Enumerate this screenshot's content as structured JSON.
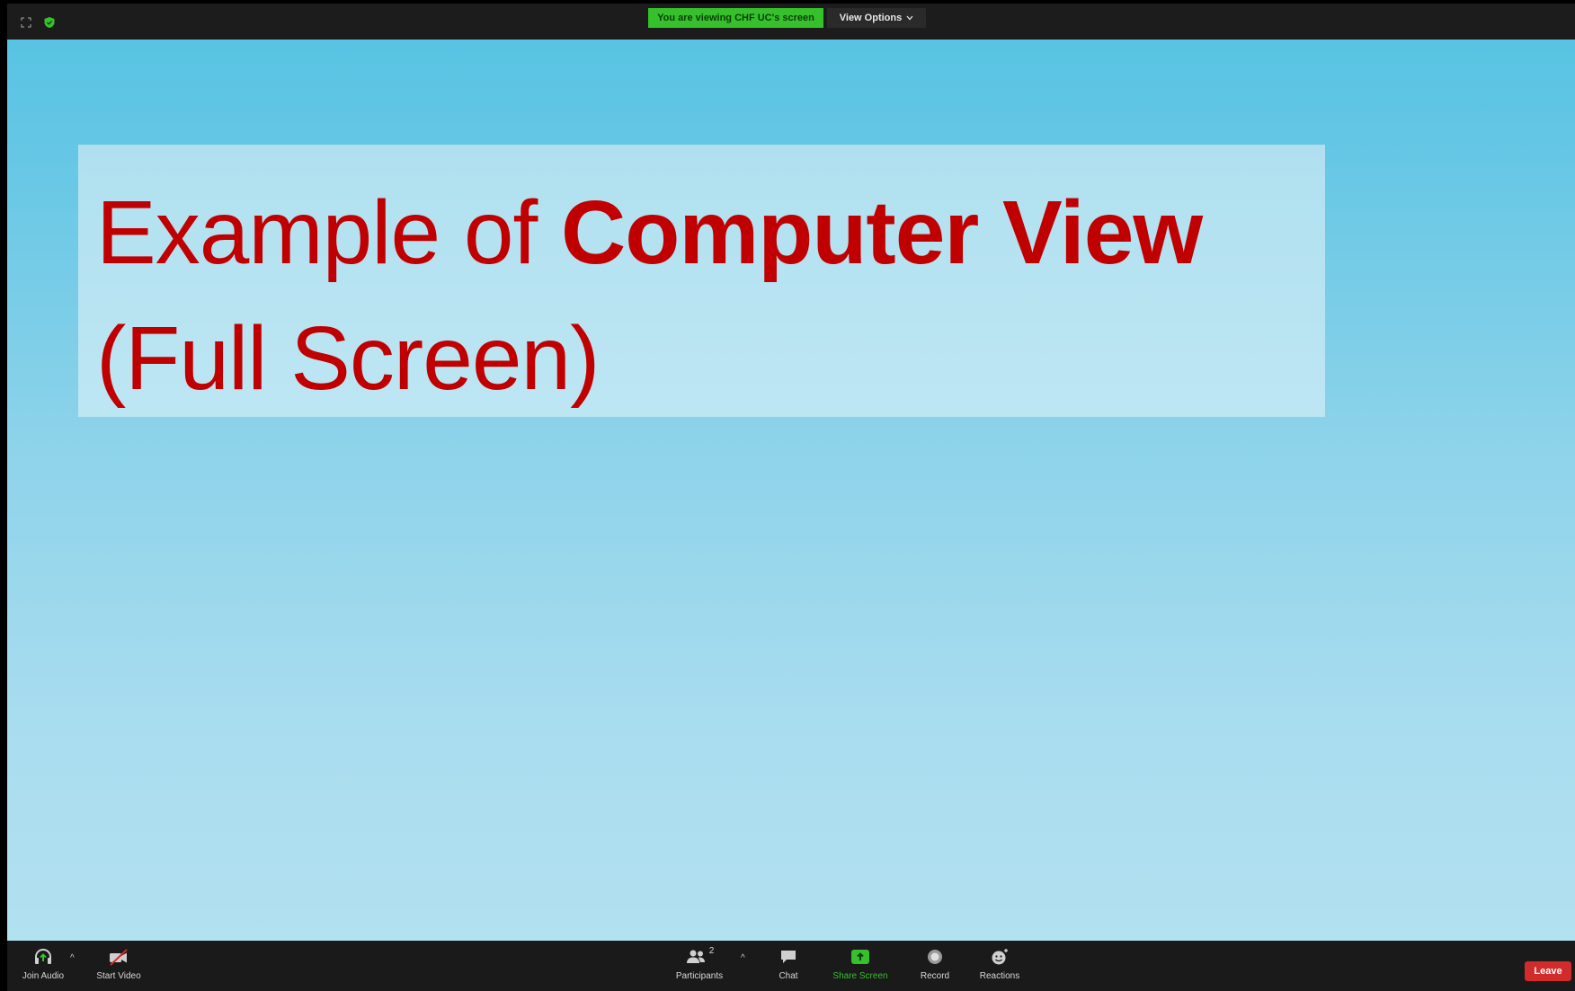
{
  "topbar": {
    "status_text": "You are viewing CHF UC's screen",
    "view_options_label": "View Options",
    "icons": [
      "expand-icon",
      "security-shield-icon",
      "chevron-down-icon"
    ]
  },
  "slide": {
    "title_part1": "Example of ",
    "title_part2": "Computer View",
    "title_line2": "(Full Screen)",
    "text_color": "#c00000"
  },
  "toolbar": {
    "join_audio": "Join Audio",
    "start_video": "Start Video",
    "participants": "Participants",
    "participants_count": "2",
    "chat": "Chat",
    "share_screen": "Share Screen",
    "record": "Record",
    "reactions": "Reactions",
    "leave": "Leave"
  },
  "colors": {
    "accent_green": "#35c02c",
    "leave_red": "#d12b2b",
    "bar_bg": "#1c1c1c"
  }
}
